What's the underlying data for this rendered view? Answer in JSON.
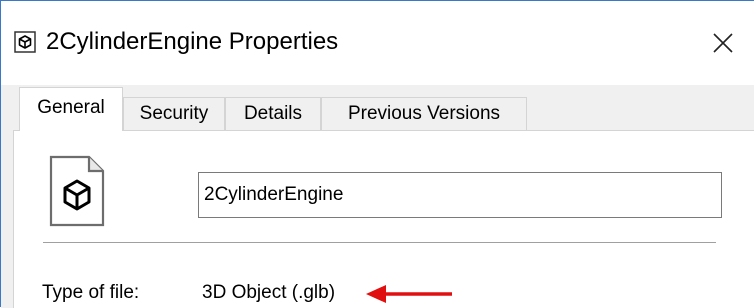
{
  "window": {
    "title": "2CylinderEngine Properties",
    "title_icon": "3d-object-cube-icon",
    "close_icon": "close-icon"
  },
  "tabs": [
    {
      "label": "General",
      "active": true
    },
    {
      "label": "Security",
      "active": false
    },
    {
      "label": "Details",
      "active": false
    },
    {
      "label": "Previous Versions",
      "active": false
    }
  ],
  "general": {
    "file_icon": "3d-object-file-icon",
    "file_name": "2CylinderEngine",
    "properties": [
      {
        "label": "Type of file:",
        "value": "3D Object (.glb)"
      }
    ],
    "annotation": {
      "type": "arrow",
      "color": "#e01010"
    }
  },
  "colors": {
    "window_border": "#3b78c8",
    "dialog_background": "#f0f0f0",
    "annotation_arrow": "#e01010"
  }
}
